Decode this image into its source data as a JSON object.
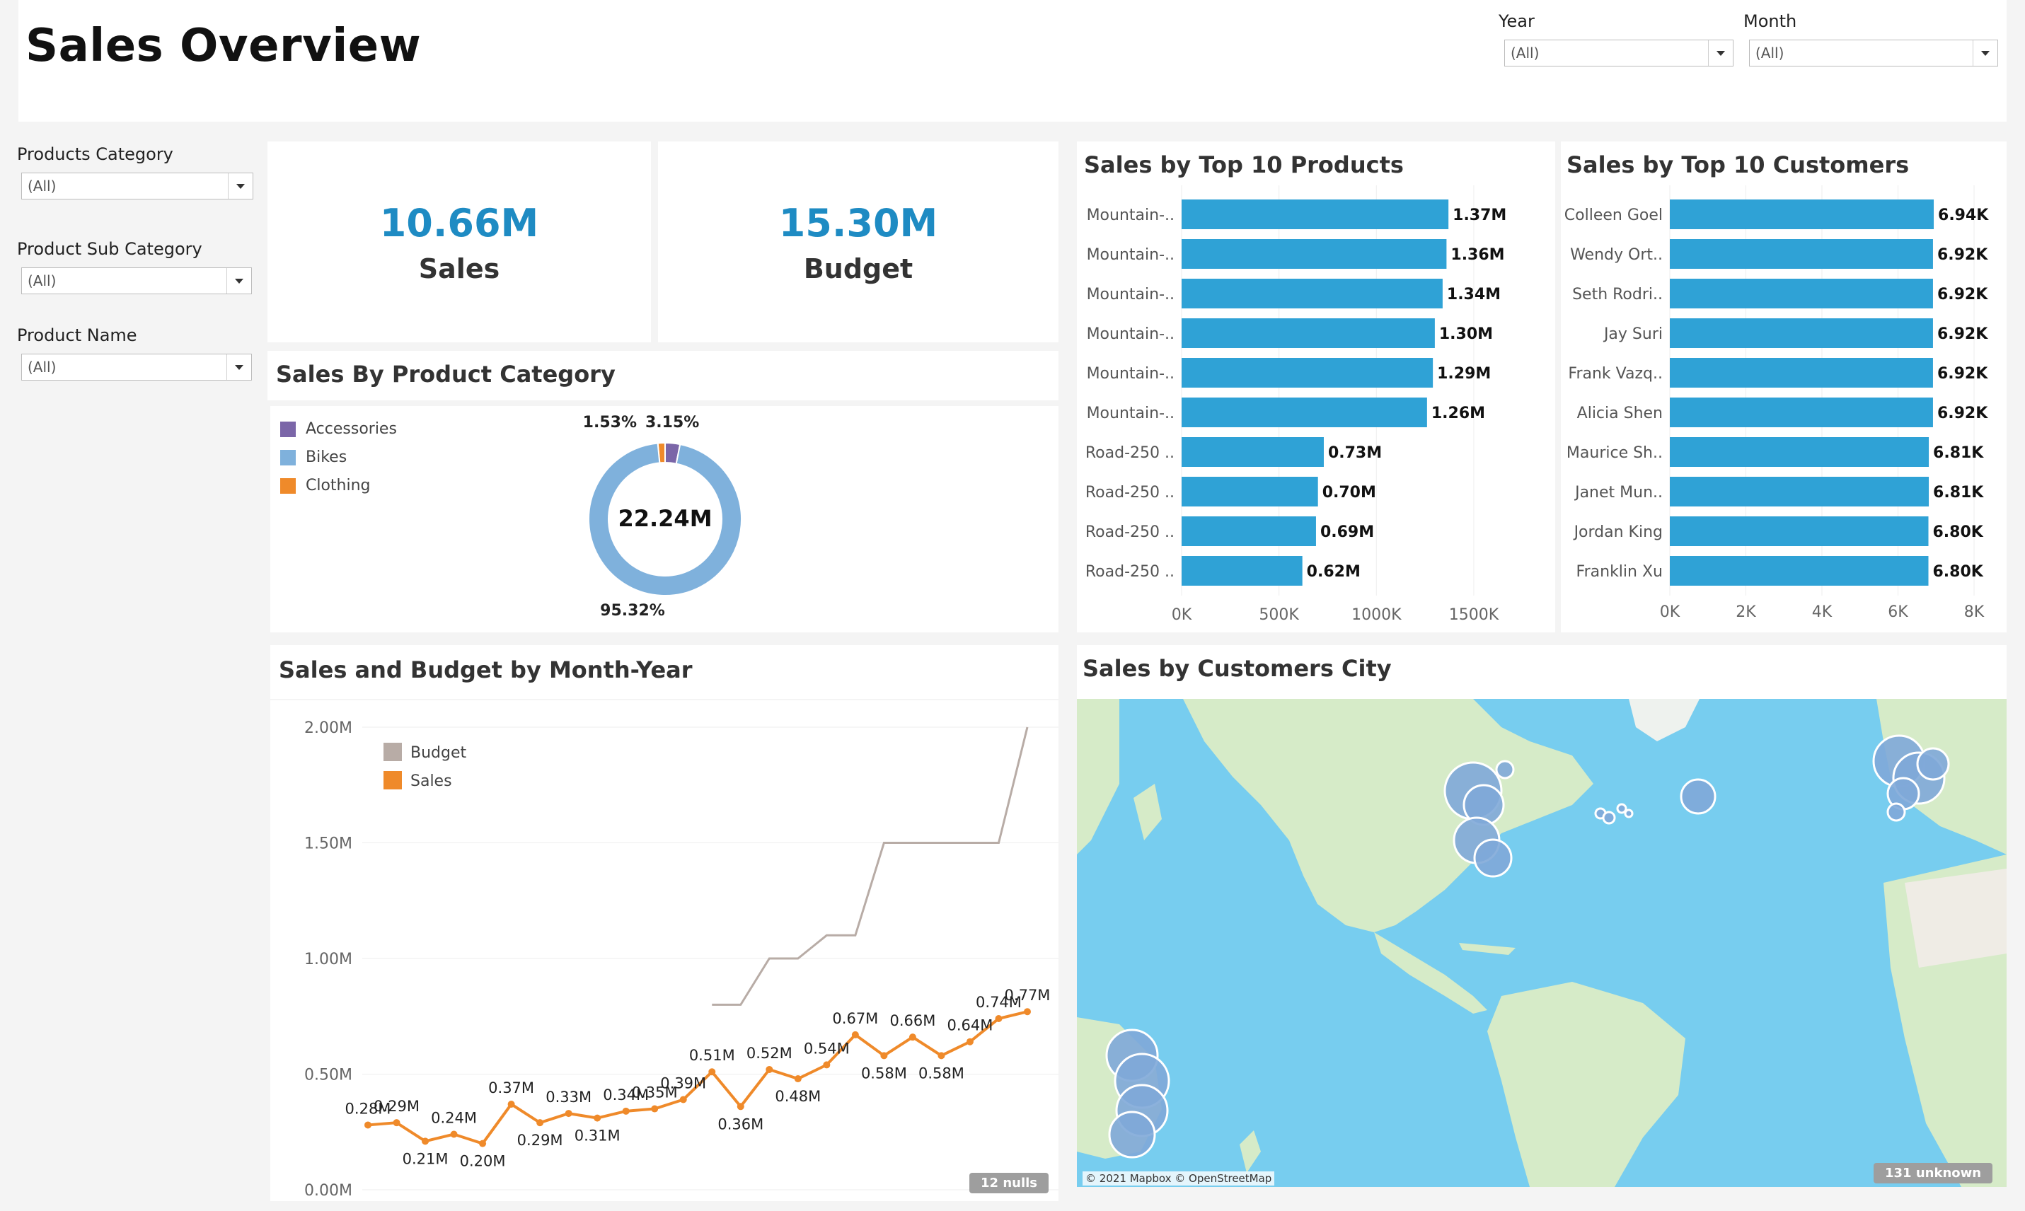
{
  "page_title": "Sales Overview",
  "filters": {
    "year": {
      "label": "Year",
      "value": "(All)"
    },
    "month": {
      "label": "Month",
      "value": "(All)"
    },
    "products_category": {
      "label": "Products Category",
      "value": "(All)"
    },
    "product_sub_category": {
      "label": "Product Sub Category",
      "value": "(All)"
    },
    "product_name": {
      "label": "Product Name",
      "value": "(All)"
    }
  },
  "kpis": {
    "sales": {
      "value": "10.66M",
      "label": "Sales"
    },
    "budget": {
      "value": "15.30M",
      "label": "Budget"
    }
  },
  "colors": {
    "kpi_blue": "#1e8bc3",
    "bar_blue": "#2fa2d6",
    "accessories": "#7b66a8",
    "bikes": "#7fb1dc",
    "clothing": "#ef8a2a",
    "budget_line": "#b8aca6",
    "sales_line": "#ef8a2a",
    "ocean": "#77cdef",
    "land": "#d6ebc8"
  },
  "category_chart": {
    "title": "Sales By Product Category",
    "center_label": "22.24M",
    "legend": [
      "Accessories",
      "Bikes",
      "Clothing"
    ]
  },
  "top_products": {
    "title": "Sales by Top 10 Products"
  },
  "top_customers": {
    "title": "Sales by Top 10 Customers"
  },
  "trend": {
    "title": "Sales and Budget by Month-Year",
    "nulls_badge": "12 nulls"
  },
  "map": {
    "title": "Sales by Customers City",
    "attribution": "© 2021 Mapbox © OpenStreetMap",
    "unknown_badge": "131 unknown"
  },
  "chart_data": [
    {
      "type": "pie",
      "name": "category_donut",
      "categories": [
        "Accessories",
        "Bikes",
        "Clothing"
      ],
      "values": [
        3.15,
        95.32,
        1.53
      ],
      "labels": [
        "3.15%",
        "95.32%",
        "1.53%"
      ],
      "colors": [
        "#7b66a8",
        "#7fb1dc",
        "#ef8a2a"
      ]
    },
    {
      "type": "bar",
      "name": "top_products",
      "categories": [
        "Mountain-..",
        "Mountain-..",
        "Mountain-..",
        "Mountain-..",
        "Mountain-..",
        "Mountain-..",
        "Road-250 ..",
        "Road-250 ..",
        "Road-250 ..",
        "Road-250 .."
      ],
      "values": [
        1370000,
        1360000,
        1340000,
        1300000,
        1290000,
        1260000,
        730000,
        700000,
        690000,
        620000
      ],
      "value_labels": [
        "1.37M",
        "1.36M",
        "1.34M",
        "1.30M",
        "1.29M",
        "1.26M",
        "0.73M",
        "0.70M",
        "0.69M",
        "0.62M"
      ],
      "xlim": [
        0,
        1700000
      ],
      "ticks": [
        0,
        500000,
        1000000,
        1500000
      ],
      "tick_labels": [
        "0K",
        "500K",
        "1000K",
        "1500K"
      ]
    },
    {
      "type": "bar",
      "name": "top_customers",
      "categories": [
        "Colleen Goel",
        "Wendy Ort..",
        "Seth Rodri..",
        "Jay Suri",
        "Frank Vazq..",
        "Alicia Shen",
        "Maurice Sh..",
        "Janet Mun..",
        "Jordan King",
        "Franklin Xu"
      ],
      "values": [
        6940,
        6920,
        6920,
        6920,
        6920,
        6920,
        6810,
        6810,
        6800,
        6800
      ],
      "value_labels": [
        "6.94K",
        "6.92K",
        "6.92K",
        "6.92K",
        "6.92K",
        "6.92K",
        "6.81K",
        "6.81K",
        "6.80K",
        "6.80K"
      ],
      "xlim": [
        0,
        8000
      ],
      "ticks": [
        0,
        2000,
        4000,
        6000,
        8000
      ],
      "tick_labels": [
        "0K",
        "2K",
        "4K",
        "6K",
        "8K"
      ]
    },
    {
      "type": "line",
      "name": "sales_budget_trend",
      "ylim": [
        0,
        2000000
      ],
      "y_ticks": [
        0,
        500000,
        1000000,
        1500000,
        2000000
      ],
      "y_tick_labels": [
        "0.00M",
        "0.50M",
        "1.00M",
        "1.50M",
        "2.00M"
      ],
      "series": [
        {
          "name": "Budget",
          "values": [
            null,
            null,
            null,
            null,
            null,
            null,
            null,
            null,
            null,
            null,
            null,
            null,
            800000,
            800000,
            1000000,
            1000000,
            1100000,
            1100000,
            1500000,
            1500000,
            1500000,
            1500000,
            1500000,
            2000000
          ]
        },
        {
          "name": "Sales",
          "values": [
            280000,
            290000,
            210000,
            240000,
            200000,
            370000,
            290000,
            330000,
            310000,
            340000,
            350000,
            390000,
            510000,
            360000,
            520000,
            480000,
            540000,
            670000,
            580000,
            660000,
            580000,
            640000,
            740000,
            770000
          ],
          "value_labels": [
            "0.28M",
            "0.29M",
            "0.21M",
            "0.24M",
            "0.20M",
            "0.37M",
            "0.29M",
            "0.33M",
            "0.31M",
            "0.34M",
            "0.35M",
            "0.39M",
            "0.51M",
            "0.36M",
            "0.52M",
            "0.48M",
            "0.54M",
            "0.67M",
            "0.58M",
            "0.66M",
            "0.58M",
            "0.64M",
            "0.74M",
            "0.77M"
          ]
        }
      ]
    }
  ]
}
